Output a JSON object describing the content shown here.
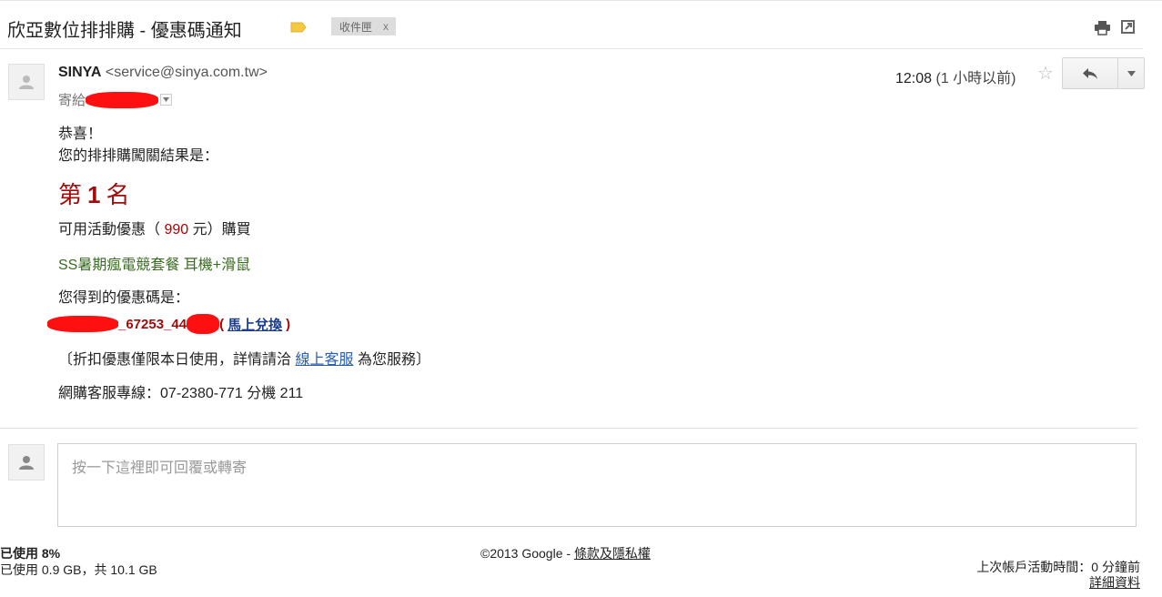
{
  "header": {
    "subject": "欣亞數位排排購 - 優惠碼通知",
    "label_chip": "收件匣",
    "label_chip_remove": "x",
    "tag_color": "#f5c842"
  },
  "message": {
    "sender_name": "SINYA",
    "sender_email": "<service@sinya.com.tw>",
    "to_prefix": "寄給",
    "time": "12:08",
    "relative_time": "(1 小時以前)",
    "greeting": "恭喜！",
    "result_intro": "您的排排購闖關結果是：",
    "rank_prefix": "第",
    "rank_number": "1",
    "rank_suffix": "名",
    "discount_prefix": "可用活動優惠（",
    "discount_amount": "990",
    "discount_suffix": "元）購買",
    "product": "SS暑期瘋電競套餐 耳機+滑鼠",
    "code_intro": "您得到的優惠碼是：",
    "code_visible": "_67253_44",
    "code_paren_open": "(",
    "redeem_link": "馬上兌換",
    "code_paren_close": ")",
    "note_prefix": "〔折扣優惠僅限本日使用，詳情請洽",
    "note_link": "線上客服",
    "note_suffix": "為您服務〕",
    "hotline_label": "網購客服專線：",
    "hotline_number": "07-2380-771",
    "hotline_ext": "分機 211"
  },
  "reply": {
    "placeholder": "按一下這裡即可回覆或轉寄"
  },
  "footer": {
    "storage_title": "已使用 8%",
    "storage_detail": "已使用 0.9 GB，共 10.1 GB",
    "copyright": "©2013 Google - ",
    "terms_link": "條款及隱私權",
    "last_activity": "上次帳戶活動時間：0 分鐘前",
    "details_link": "詳細資料"
  },
  "colors": {
    "accent_red": "#a00d0d",
    "product_green": "#3a6b23",
    "link_blue": "#2a5db0",
    "redaction": "#ff1010"
  }
}
